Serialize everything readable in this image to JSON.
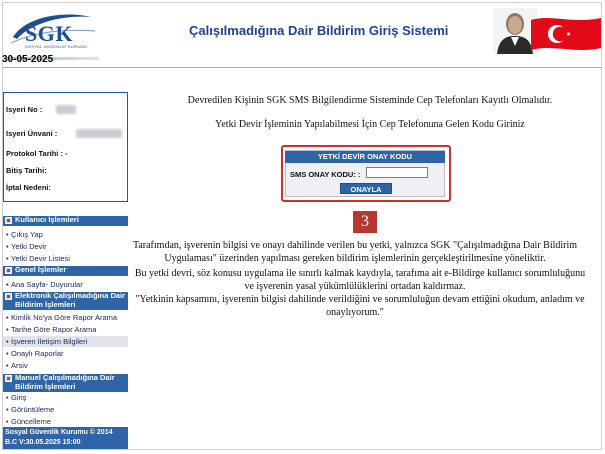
{
  "header": {
    "logo_text": "SGK",
    "logo_subtext": "SOSYAL GÜVENLİK KURUMU",
    "title": "Çalışılmadığına Dair Bildirim Giriş Sistemi"
  },
  "date": "30-05-2025",
  "info": {
    "isyeri_no_label": "Isyeri No :",
    "isyeri_unvani_label": "Isyeri Ünvani :",
    "protokol_tarihi_label": "Protokol Tarihi : -",
    "bitis_tarihi_label": "Bitiş Tarihi:",
    "iptal_nedeni_label": "İptal Nedeni:"
  },
  "menu": {
    "sections": [
      {
        "header": "Kullanıcı İşlemleri",
        "items": [
          "Çıkış Yap",
          "Yetki Devir",
          "Yetki Devir Listesi"
        ]
      },
      {
        "header": "Genel İşlemler",
        "items": [
          "Ana Sayfa- Duyurular"
        ]
      },
      {
        "header": "Elektronik Çalışılmadığına Dair Bildirim İşlemleri",
        "items": [
          "Kimlik No'ya Göre Rapor Arama",
          "Tarihe Göre Rapor Arama",
          "İşveren İletişim Bilgileri",
          "Onaylı Raporlar",
          "Arsiv"
        ]
      },
      {
        "header": "Manuel Çalışılmadığına Dair Bildirim İşlemleri",
        "items": [
          "Giriş",
          "Görüntüleme",
          "Güncelleme"
        ]
      }
    ],
    "footer": "Sosyal Güvenlik Kurumu © 2014 B.C V:30.05.2025 15:00"
  },
  "main": {
    "line1": "Devredilen Kişinin SGK SMS Bilgilendirme Sisteminde Cep Telefonları Kayıtlı Olmalıdır.",
    "line2": "Yetki Devir İşleminin Yapılabilmesi İçin Cep Telefonuna Gelen Kodu Giriniz",
    "verify_title": "YETKİ DEVİR ONAY KODU",
    "sms_label": "SMS ONAY KODU: :",
    "sms_value": "",
    "confirm_button": "ONAYLA",
    "step_number": "3",
    "para1_line1": "Tarafımdan, işverenin bilgisi ve onayı dahilinde verilen bu yetki, yalnızca SGK \"Çalışılmadığına Dair Bildirim",
    "para1_line2": "Uygulaması\" üzerinden yapılması gereken bildirim işlemlerinin gerçekleştirilmesine yöneliktir.",
    "para2_line1": "Bu yetki devri, söz konusu uygulama ile sınırlı kalmak kaydıyla, tarafıma ait e-Bildirge kullanıcı sorumluluğunu",
    "para2_line2": "ve işverenin yasal yükümlülüklerini ortadan kaldırmaz.",
    "para3_line1": "\"Yetkinin kapsamını, işverenin bilgisi dahilinde verildiğini ve sorumluluğun devam ettiğini okudum, anladım ve",
    "para3_line2": "onaylıyorum.\""
  },
  "colors": {
    "brand_blue": "#2f64a6",
    "title_blue": "#20409a",
    "highlight_red": "#c9332e",
    "flag_red": "#e30a17"
  }
}
